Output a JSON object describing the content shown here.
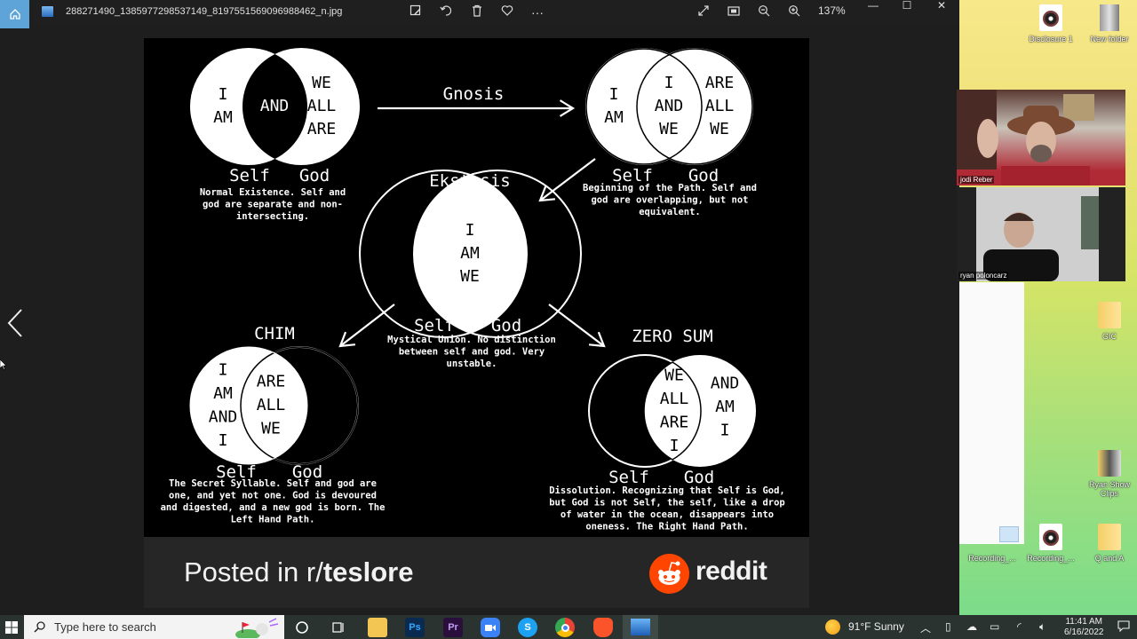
{
  "viewer": {
    "file_name": "288271490_1385977298537149_8197551569096988462_n.jpg",
    "zoom_level": "137%",
    "toolbar_icons": [
      "edit-image-icon",
      "rotate-icon",
      "delete-icon",
      "favorite-heart-icon",
      "more-options-icon"
    ],
    "right_icons": [
      "fullscreen-icon",
      "fit-to-window-icon",
      "zoom-out-icon",
      "zoom-in-icon"
    ],
    "window_controls": [
      "minimize",
      "maximize",
      "close"
    ]
  },
  "diagram": {
    "arrow_labels": {
      "gnosis": "Gnosis"
    },
    "stages": {
      "normal": {
        "left_text": [
          "I",
          "AM"
        ],
        "center_text": "AND",
        "right_text": [
          "WE",
          "ALL",
          "ARE"
        ],
        "self_label": "Self",
        "god_label": "God",
        "caption": [
          "Normal Existence. Self and",
          "god are separate and non-",
          "intersecting."
        ]
      },
      "beginning": {
        "left_text": [
          "I",
          "AM"
        ],
        "center_text": [
          "I",
          "AND",
          "WE"
        ],
        "right_text": [
          "ARE",
          "ALL",
          "WE"
        ],
        "self_label": "Self",
        "god_label": "God",
        "caption": [
          "Beginning of the Path. Self and",
          "god are overlapping, but not",
          "equivalent."
        ]
      },
      "ekstasis": {
        "title": "Ekstasis",
        "center_text": [
          "I",
          "AM",
          "WE"
        ],
        "self_label": "Self",
        "god_label": "God",
        "caption": [
          "Mystical Union. No distinction",
          "between self and god. Very",
          "unstable."
        ]
      },
      "chim": {
        "title": "CHIM",
        "left_text": [
          "I",
          "AM",
          "AND",
          "I"
        ],
        "center_text": [
          "ARE",
          "ALL",
          "WE"
        ],
        "self_label": "Self",
        "god_label": "God",
        "caption": [
          "The Secret Syllable. Self and god are",
          "one, and yet not one. God is devoured",
          "and digested, and a new god is born. The",
          "Left Hand Path."
        ]
      },
      "zero_sum": {
        "title": "ZERO SUM",
        "center_text": [
          "WE",
          "ALL",
          "ARE",
          "I"
        ],
        "right_text": [
          "AND",
          "AM",
          "I"
        ],
        "self_label": "Self",
        "god_label": "God",
        "caption": [
          "Dissolution. Recognizing that Self is God,",
          "but God is not Self, the self, like a drop",
          "of water in the ocean, disappears into",
          "oneness. The Right Hand Path."
        ]
      }
    }
  },
  "footer": {
    "posted_prefix": "Posted in r/",
    "subreddit": "teslore",
    "brand": "reddit",
    "brand_color": "#ff4500"
  },
  "video_call": {
    "participants": [
      {
        "name": "jodi Reber"
      },
      {
        "name": "ryan poloncarz"
      }
    ]
  },
  "desktop": {
    "icons": [
      {
        "label": "Disclosure 1",
        "type": "media-file"
      },
      {
        "label": "New folder",
        "type": "folder"
      },
      {
        "label": "GIC",
        "type": "folder"
      },
      {
        "label": "Ryan Show Clips",
        "type": "folder"
      },
      {
        "label": "Recording_...",
        "type": "media-file"
      },
      {
        "label": "Recording_...",
        "type": "media-file"
      },
      {
        "label": "Q and A",
        "type": "folder"
      }
    ]
  },
  "taskbar": {
    "search_placeholder": "Type here to search",
    "apps": [
      "file-explorer",
      "photoshop",
      "premiere-pro",
      "zoom",
      "skype",
      "chrome",
      "brave",
      "photos"
    ],
    "app_labels": {
      "photoshop": "Ps",
      "premiere": "Pr",
      "skype": "S"
    },
    "weather": "91°F  Sunny",
    "time": "11:41 AM",
    "date": "6/16/2022"
  }
}
